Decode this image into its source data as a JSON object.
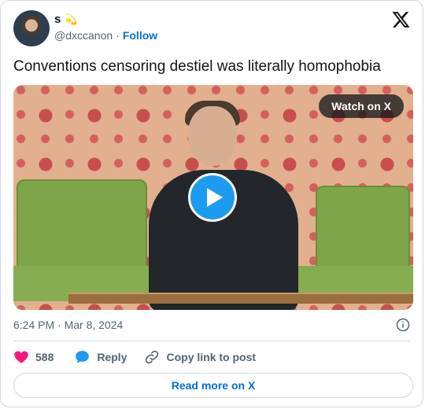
{
  "author": {
    "name": "s",
    "emoji": "💫",
    "handle": "@dxccanon",
    "separator": "·",
    "follow_label": "Follow"
  },
  "tweet": {
    "text": "Conventions censoring destiel was literally homophobia",
    "timestamp": "6:24 PM · Mar 8, 2024"
  },
  "media": {
    "watch_label": "Watch on X",
    "play_icon": "play-icon"
  },
  "actions": {
    "like_count": "588",
    "reply_label": "Reply",
    "copy_label": "Copy link to post"
  },
  "footer": {
    "read_more_label": "Read more on X"
  },
  "colors": {
    "accent": "#1d9bf0",
    "like": "#f91880",
    "link": "#006fd6"
  }
}
